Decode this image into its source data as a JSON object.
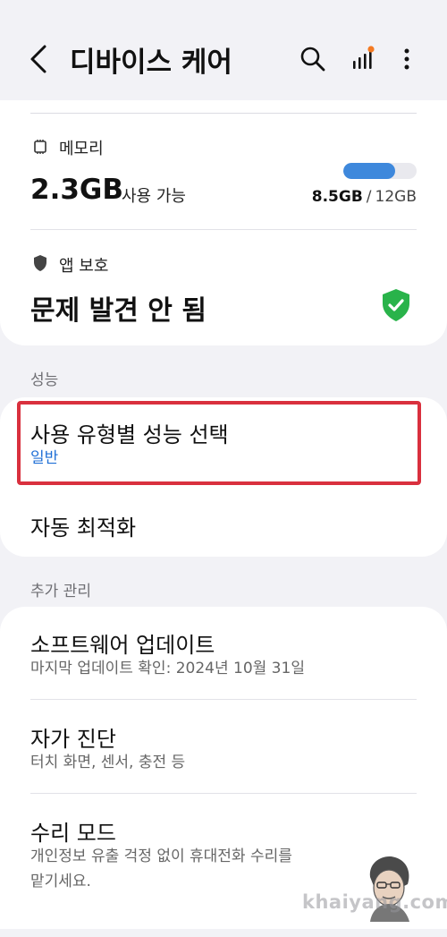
{
  "header": {
    "title": "디바이스 케어",
    "back_icon": "chevron-left-icon",
    "search_icon": "search-icon",
    "signal_icon": "signal-bars-icon",
    "more_icon": "more-vertical-icon",
    "notification_dot_color": "#f47a22"
  },
  "memory": {
    "label": "메모리",
    "icon": "memory-chip-icon",
    "value": "2.3GB",
    "available_label": "사용 가능",
    "used": "8.5GB",
    "separator": "/",
    "total": "12GB",
    "usage_fraction": 0.71,
    "bar_color": "#3e88dc"
  },
  "app_protection": {
    "label": "앱 보호",
    "icon": "shield-icon",
    "status": "문제 발견 안 됨",
    "status_icon": "shield-check-icon",
    "status_color": "#29b34a"
  },
  "performance": {
    "section_label": "성능",
    "items": [
      {
        "title": "사용 유형별 성능 선택",
        "subtitle": "일반"
      },
      {
        "title": "자동 최적화"
      }
    ]
  },
  "additional": {
    "section_label": "추가 관리",
    "items": [
      {
        "title": "소프트웨어 업데이트",
        "subtitle": "마지막 업데이트 확인: 2024년 10월 31일"
      },
      {
        "title": "자가 진단",
        "subtitle": "터치 화면, 센서, 충전 등"
      },
      {
        "title": "수리 모드",
        "subtitle_line1": "개인정보 유출 걱정 없이 휴대전화 수리를",
        "subtitle_line2": "맡기세요."
      }
    ]
  },
  "watermark": {
    "text": "khaiyang.com"
  },
  "highlight_color": "#d9303e"
}
